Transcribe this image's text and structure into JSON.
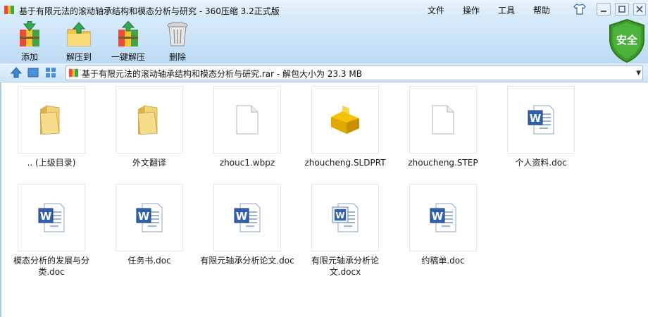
{
  "window": {
    "title": "基于有限元法的滚动轴承结构和模态分析与研究 - 360压缩 3.2正式版"
  },
  "menu": [
    "文件",
    "操作",
    "工具",
    "帮助"
  ],
  "toolbar": {
    "add": "添加",
    "extract_to": "解压到",
    "one_click_extract": "一键解压",
    "delete": "删除"
  },
  "security_badge": "安全",
  "address": {
    "path": "基于有限元法的滚动轴承结构和模态分析与研究.rar - 解包大小为 23.3 MB"
  },
  "files": [
    {
      "name": ".. (上级目录)",
      "icon": "folder-icon"
    },
    {
      "name": "外文翻译",
      "icon": "folder-icon"
    },
    {
      "name": "zhouc1.wbpz",
      "icon": "blank-file-icon"
    },
    {
      "name": "zhoucheng.SLDPRT",
      "icon": "solidworks-part-icon"
    },
    {
      "name": "zhoucheng.STEP",
      "icon": "blank-file-icon"
    },
    {
      "name": "个人资料.doc",
      "icon": "word-doc-icon"
    },
    {
      "name": "模态分析的发展与分类.doc",
      "icon": "word-doc-icon"
    },
    {
      "name": "任务书.doc",
      "icon": "word-doc-icon"
    },
    {
      "name": "有限元轴承分析论文.doc",
      "icon": "word-doc-icon"
    },
    {
      "name": "有限元轴承分析论文.docx",
      "icon": "word-docx-icon"
    },
    {
      "name": "约稿单.doc",
      "icon": "word-doc-icon"
    }
  ],
  "colors": {
    "titlebar": "#d3e8f8",
    "toolbar": "#bcdaf4",
    "shield_green": "#3e9a2c"
  }
}
